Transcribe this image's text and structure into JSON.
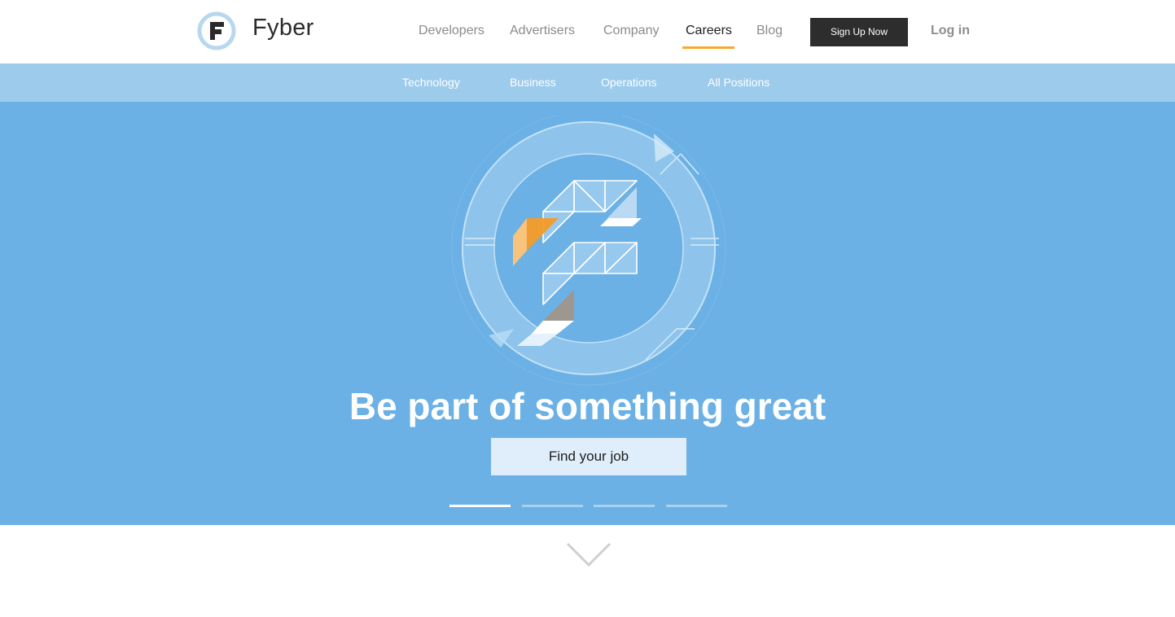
{
  "header": {
    "brand": "Fyber",
    "nav": [
      {
        "label": "Developers",
        "active": false
      },
      {
        "label": "Advertisers",
        "active": false
      },
      {
        "label": "Company",
        "active": false
      },
      {
        "label": "Careers",
        "active": true
      },
      {
        "label": "Blog",
        "active": false
      }
    ],
    "signup_label": "Sign Up Now",
    "login_label": "Log in"
  },
  "subnav": {
    "items": [
      "Technology",
      "Business",
      "Operations",
      "All Positions"
    ]
  },
  "hero": {
    "headline": "Be part of something great",
    "cta_label": "Find your job",
    "slides_total": 4,
    "active_slide": 1
  },
  "colors": {
    "accent": "#f7a92e",
    "hero_bg": "#6bb1e5",
    "subnav_bg": "#9ccbec",
    "signup_bg": "#2d2d2d",
    "cta_bg": "#dfeefa"
  },
  "icons": {
    "logo": "fyber-logo-icon",
    "hero": "fyber-emblem-icon",
    "scroll": "chevron-down-icon"
  }
}
